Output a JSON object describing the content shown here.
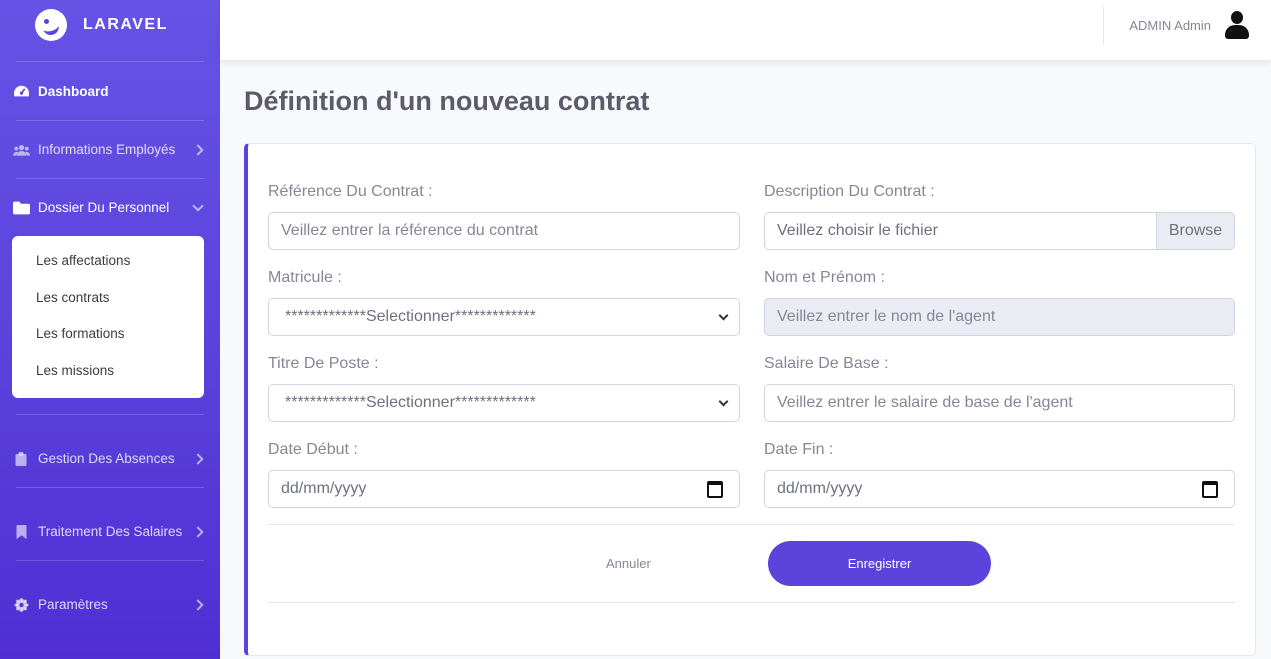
{
  "sidebar": {
    "brand": "LARAVEL",
    "dashboard": "Dashboard",
    "items": [
      {
        "label": "Informations Employés"
      },
      {
        "label": "Dossier Du Personnel"
      },
      {
        "label": "Gestion Des Absences"
      },
      {
        "label": "Traitement Des Salaires"
      },
      {
        "label": "Paramètres"
      }
    ],
    "submenu": [
      "Les affectations",
      "Les contrats",
      "Les formations",
      "Les missions"
    ]
  },
  "topbar": {
    "user": "ADMIN Admin"
  },
  "page": {
    "title": "Définition d'un nouveau contrat"
  },
  "form": {
    "reference_label": "Référence Du Contrat :",
    "reference_placeholder": "Veillez entrer la référence du contrat",
    "description_label": "Description Du Contrat :",
    "file_label": "Veillez choisir le fichier",
    "browse": "Browse",
    "matricule_label": "Matricule :",
    "matricule_value": "*************Selectionner*************",
    "nom_label": "Nom et Prénom :",
    "nom_placeholder": "Veillez entrer le nom de l'agent",
    "titre_label": "Titre De Poste :",
    "titre_value": "*************Selectionner*************",
    "salaire_label": "Salaire De Base :",
    "salaire_placeholder": "Veillez entrer le salaire de base de l'agent",
    "debut_label": "Date Début :",
    "debut_value": "dd/mm/yyyy",
    "fin_label": "Date Fin :",
    "fin_value": "dd/mm/yyyy",
    "cancel": "Annuler",
    "save": "Enregistrer"
  },
  "colors": {
    "primary": "#5b43dc",
    "sidebar_top": "#6653e6",
    "sidebar_bottom": "#4f2fd4"
  }
}
